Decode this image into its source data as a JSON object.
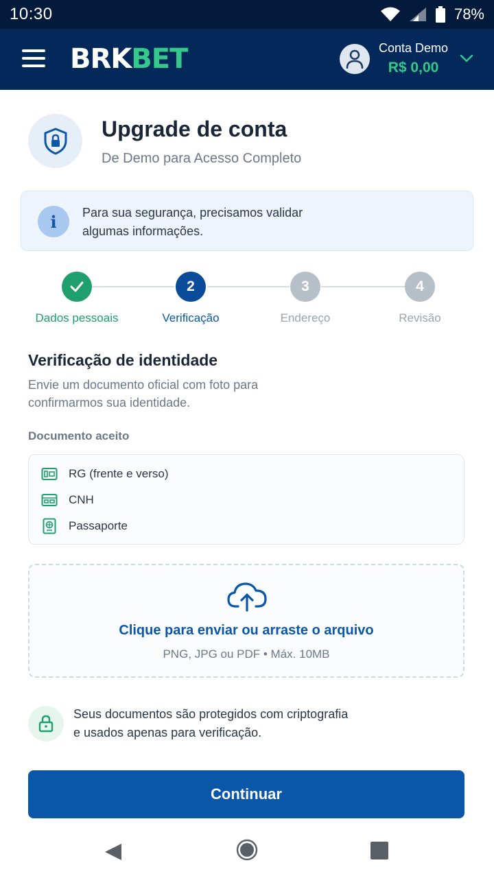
{
  "status_bar": {
    "time": "10:30",
    "battery": "78%"
  },
  "header": {
    "logo_part1": "BRK",
    "logo_part2": "BET",
    "account_name": "Conta Demo",
    "account_balance": "R$ 0,00"
  },
  "page": {
    "title": "Upgrade de conta",
    "subtitle": "De Demo para Acesso Completo"
  },
  "info": {
    "line1": "Para sua segurança, precisamos validar",
    "line2": "algumas informações."
  },
  "stepper": {
    "current_step": 2,
    "steps": [
      {
        "number": "1",
        "label": "Dados pessoais",
        "state": "done"
      },
      {
        "number": "2",
        "label": "Verificação",
        "state": "active"
      },
      {
        "number": "3",
        "label": "Endereço",
        "state": "pending"
      },
      {
        "number": "4",
        "label": "Revisão",
        "state": "pending"
      }
    ]
  },
  "verification": {
    "title": "Verificação de identidade",
    "desc_line1": "Envie um documento oficial com foto para",
    "desc_line2": "confirmarmos sua identidade.",
    "accepted_heading": "Documento aceito",
    "documents": [
      {
        "label": "RG (frente e verso)",
        "icon": "id-card-icon"
      },
      {
        "label": "CNH",
        "icon": "driver-license-icon"
      },
      {
        "label": "Passaporte",
        "icon": "passport-icon"
      }
    ]
  },
  "upload": {
    "icon": "cloud-upload-icon",
    "title": "Clique para enviar ou arraste o arquivo",
    "subtitle": "PNG, JPG ou PDF • Máx. 10MB"
  },
  "security": {
    "line1": "Seus documentos são protegidos com criptografia",
    "line2": "e usados apenas para verificação."
  },
  "actions": {
    "continue_label": "Continuar"
  },
  "colors": {
    "header_bg": "#03295a",
    "status_bg": "#031a3b",
    "brand_green": "#33c98b",
    "primary_blue": "#0a56a9",
    "step_done": "#1f9e6e",
    "step_pending": "#b7bfc9"
  }
}
